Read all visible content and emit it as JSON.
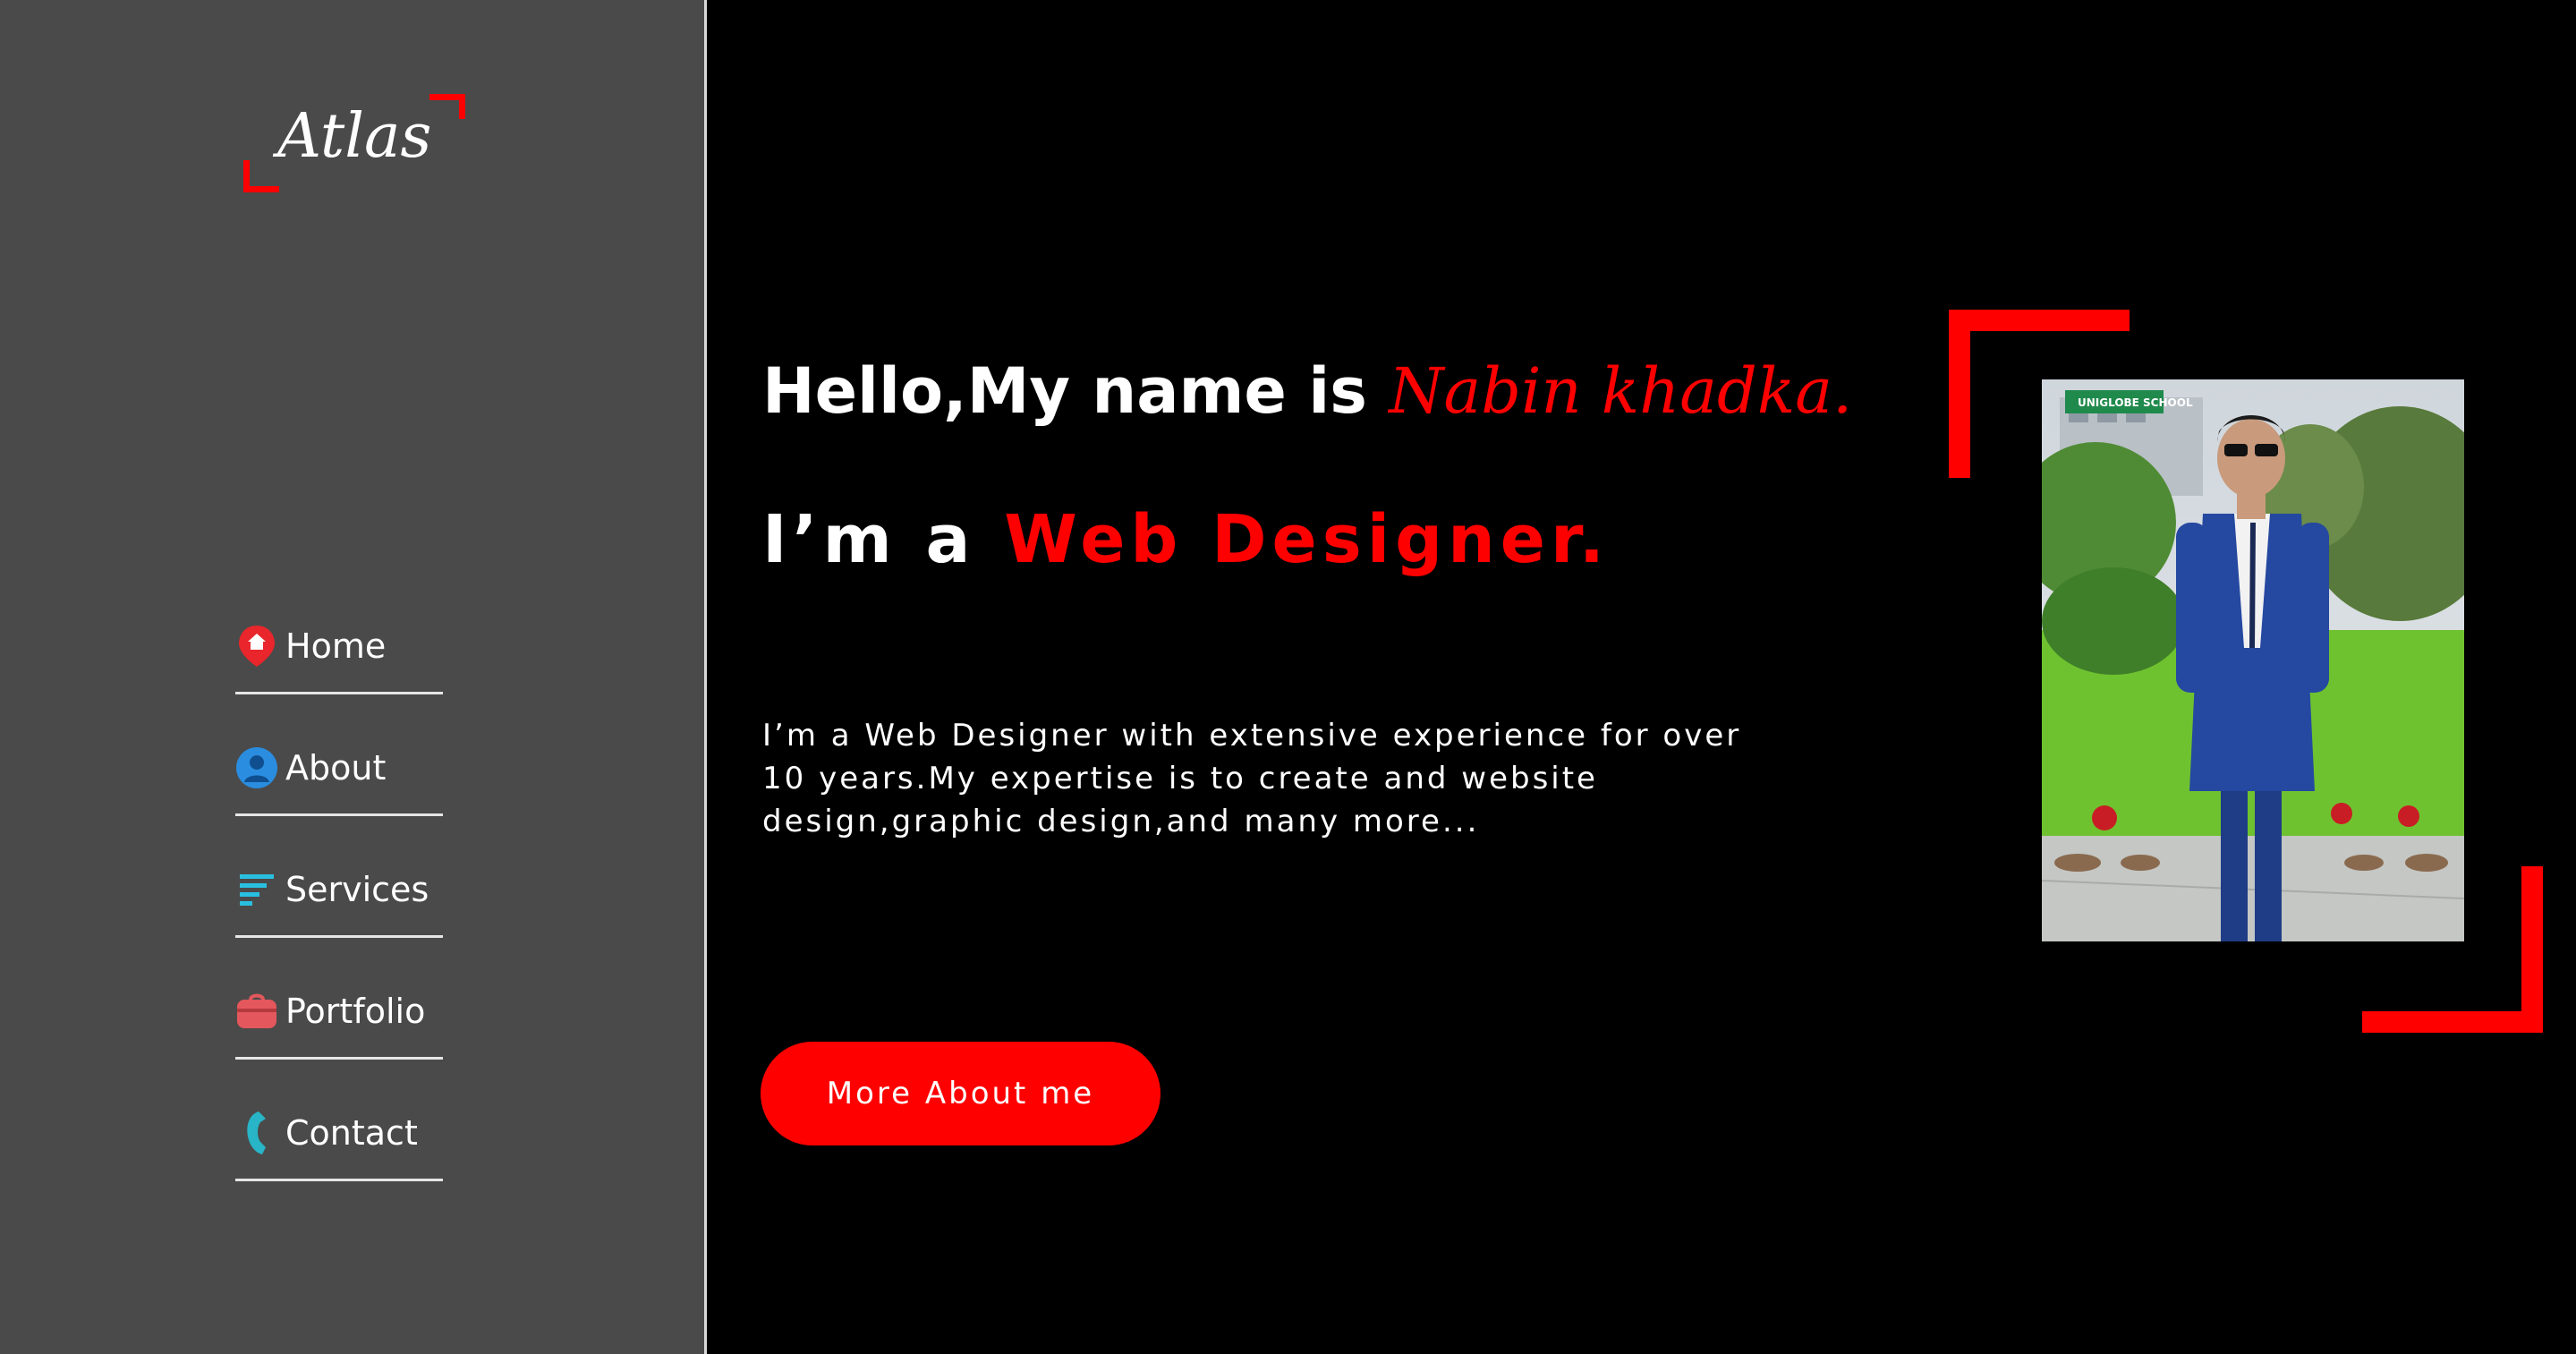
{
  "sidebar": {
    "logo": "Atlas",
    "nav": [
      {
        "label": "Home",
        "icon": "home-pin-icon"
      },
      {
        "label": "About",
        "icon": "user-icon"
      },
      {
        "label": "Services",
        "icon": "list-icon"
      },
      {
        "label": "Portfolio",
        "icon": "briefcase-icon"
      },
      {
        "label": "Contact",
        "icon": "phone-icon"
      }
    ]
  },
  "hero": {
    "greeting": "Hello,My name is",
    "name": "Nabin khadka.",
    "role_prefix": "I’m a",
    "role": "Web Designer.",
    "description": "I’m a Web Designer with extensive experience for over 10 years.My expertise is to create and website design,graphic design,and many more...",
    "cta_label": "More About me",
    "photo_sign": "UNIGLOBE SCHOOL"
  },
  "colors": {
    "accent": "#ff0000",
    "sidebar_bg": "#4a4a4a",
    "main_bg": "#000000"
  }
}
